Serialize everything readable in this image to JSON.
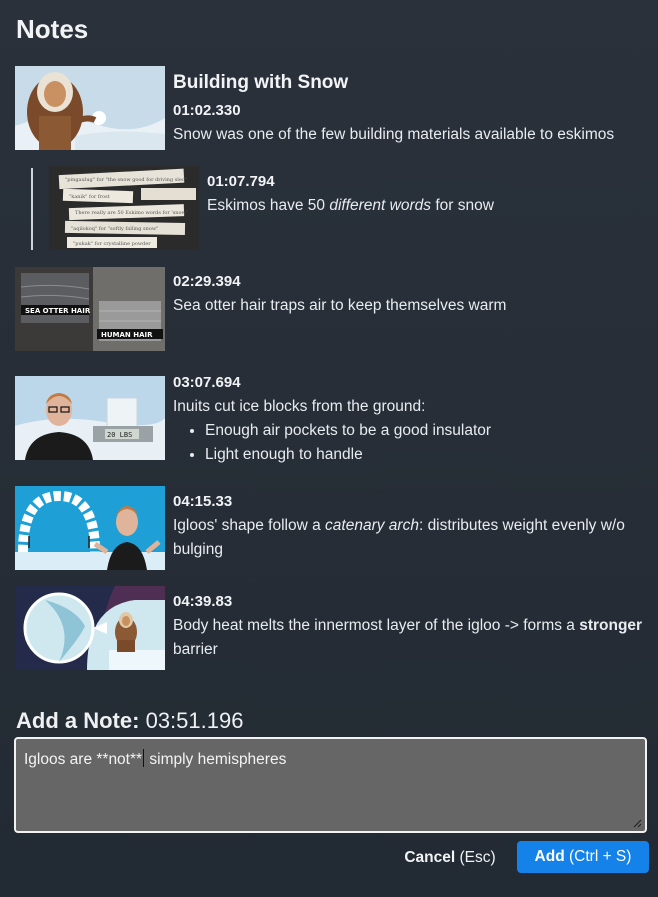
{
  "panel": {
    "title": "Notes"
  },
  "notes": [
    {
      "heading": "Building with Snow",
      "timestamp": "01:02.330",
      "text": "Snow was one of the few building materials available to eskimos"
    },
    {
      "timestamp": "01:07.794",
      "text_before": "Eskimos have 50 ",
      "text_em": "different words",
      "text_after": " for snow"
    },
    {
      "timestamp": "02:29.394",
      "text": "Sea otter hair traps air to keep themselves warm",
      "thumb_labels": [
        "SEA OTTER HAIR",
        "HUMAN HAIR"
      ]
    },
    {
      "timestamp": "03:07.694",
      "text": "Inuits cut ice blocks from the ground:",
      "bullets": [
        "Enough air pockets to be a good insulator",
        "Light enough to handle"
      ],
      "thumb_scale_readout": "20 LBS"
    },
    {
      "timestamp": "04:15.33",
      "text_before": "Igloos' shape follow a ",
      "text_em": "catenary arch",
      "text_after": ": distributes weight evenly w/o bulging"
    },
    {
      "timestamp": "04:39.83",
      "text_before": "Body heat melts the innermost layer of the igloo -> forms a ",
      "text_strong": "stronger",
      "text_after": " barrier"
    }
  ],
  "add_note": {
    "label": "Add a Note:",
    "time": "03:51.196",
    "value_before_cursor": "Igloos are **not**",
    "value_after_cursor": " simply hemispheres"
  },
  "buttons": {
    "cancel_label": "Cancel",
    "cancel_hint": "(Esc)",
    "add_label": "Add",
    "add_hint": "(Ctrl + S)"
  },
  "colors": {
    "accent": "#1482e8",
    "background": "#262d36",
    "input_bg": "#666666"
  }
}
